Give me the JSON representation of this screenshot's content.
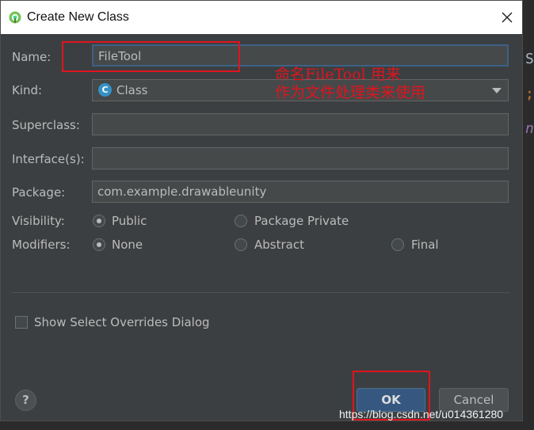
{
  "window": {
    "title": "Create New Class",
    "close_glyph": "✕"
  },
  "form": {
    "name": {
      "label": "Name:",
      "value": "FileTool"
    },
    "kind": {
      "label": "Kind:",
      "value": "Class",
      "icon_letter": "C"
    },
    "superclass": {
      "label": "Superclass:",
      "value": ""
    },
    "interfaces": {
      "label": "Interface(s):",
      "value": ""
    },
    "package": {
      "label": "Package:",
      "value": "com.example.drawableunity"
    },
    "visibility": {
      "label": "Visibility:",
      "options": [
        "Public",
        "Package Private"
      ],
      "selected": "Public"
    },
    "modifiers": {
      "label": "Modifiers:",
      "options": [
        "None",
        "Abstract",
        "Final"
      ],
      "selected": "None"
    },
    "show_overrides": {
      "label": "Show Select Overrides Dialog",
      "checked": false
    }
  },
  "buttons": {
    "help": "?",
    "ok": "OK",
    "cancel": "Cancel"
  },
  "annotation": {
    "line1": "命名FileTool 用来",
    "line2": "作为文件处理类来使用"
  },
  "editor_fragments": [
    "S",
    ";",
    "na"
  ],
  "watermark": "https://blog.csdn.net/u014361280",
  "colors": {
    "annotation": "#e0141e",
    "ok_button": "#365880",
    "dialog_bg": "#3c3f41"
  }
}
